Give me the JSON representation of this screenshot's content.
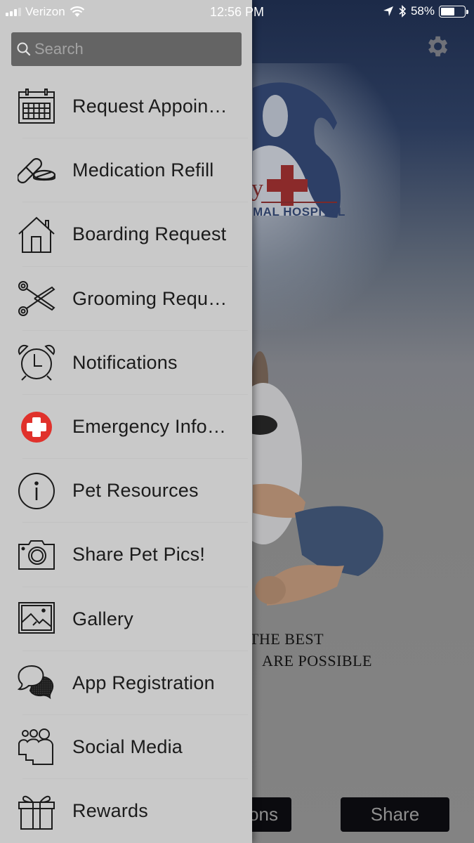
{
  "status_bar": {
    "carrier": "Verizon",
    "time": "12:56 PM",
    "battery_percent": "58%",
    "battery_level": 0.58,
    "icons": [
      "signal-icon",
      "wifi-icon",
      "location-arrow-icon",
      "bluetooth-icon",
      "battery-icon"
    ]
  },
  "drawer": {
    "search": {
      "placeholder": "Search",
      "value": "",
      "icon": "search-icon"
    },
    "items": [
      {
        "label": "Request Appoin…",
        "icon": "calendar-icon"
      },
      {
        "label": "Medication Refill",
        "icon": "pills-icon"
      },
      {
        "label": "Boarding Request",
        "icon": "house-icon"
      },
      {
        "label": "Grooming Requ…",
        "icon": "scissors-icon"
      },
      {
        "label": "Notifications",
        "icon": "alarm-clock-icon"
      },
      {
        "label": "Emergency Info…",
        "icon": "red-cross-icon"
      },
      {
        "label": "Pet Resources",
        "icon": "info-icon"
      },
      {
        "label": "Share Pet Pics!",
        "icon": "camera-icon"
      },
      {
        "label": "Gallery",
        "icon": "image-icon"
      },
      {
        "label": "App Registration",
        "icon": "chat-bubbles-icon"
      },
      {
        "label": "Social Media",
        "icon": "people-icon"
      },
      {
        "label": "Rewards",
        "icon": "gift-icon"
      }
    ]
  },
  "background_app": {
    "settings_icon": "gear-icon",
    "logo_text": "MAL HOSPITAL",
    "logo_letter": "y",
    "tagline": [
      "THE BEST",
      "ARE POSSIBLE"
    ],
    "buttons": {
      "options_label": "ons",
      "share_label": "Share"
    }
  },
  "colors": {
    "drawer_bg": "#c9c9c9",
    "search_bg": "#646464",
    "emergency_red": "#e0312b",
    "logo_navy": "#2d3f66",
    "logo_red": "#8b2a2a"
  }
}
